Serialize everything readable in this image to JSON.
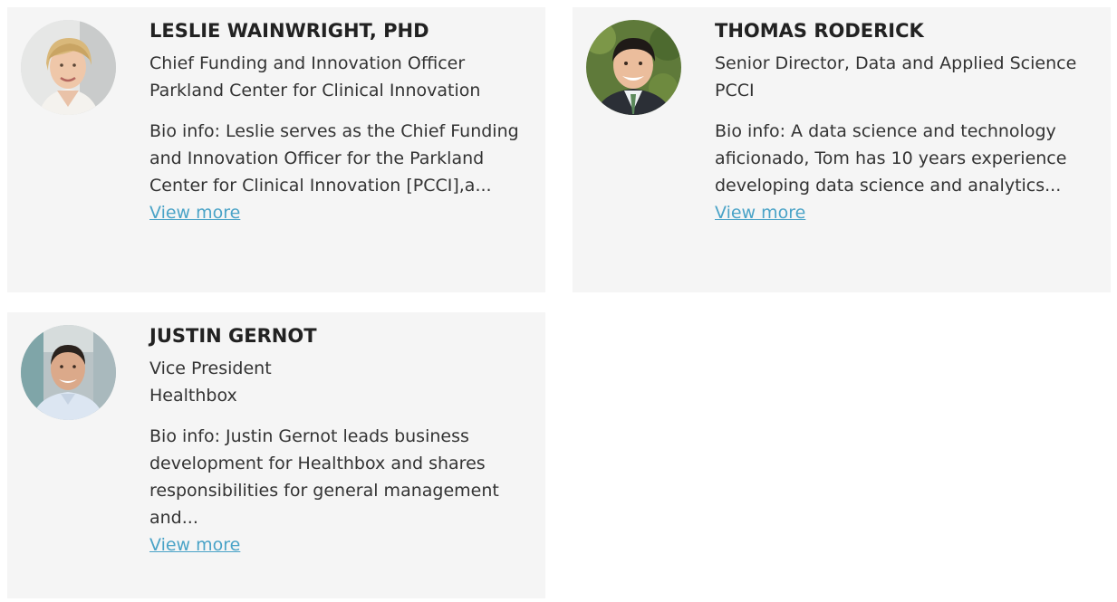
{
  "people": [
    {
      "name": "LESLIE WAINWRIGHT, PHD",
      "title": "Chief Funding and Innovation Officer",
      "organization": "Parkland Center for Clinical Innovation",
      "bio": "Bio info: Leslie serves as the Chief Funding and Innovation Officer for the Parkland Center for Clinical Innovation [PCCI],a...",
      "link_label": "View more"
    },
    {
      "name": "THOMAS RODERICK",
      "title": "Senior Director, Data and Applied Science",
      "organization": "PCCI",
      "bio": "Bio info: A data science and technology aficionado, Tom has 10 years experience developing data science and analytics...",
      "link_label": "View more"
    },
    {
      "name": "JUSTIN GERNOT",
      "title": "Vice President",
      "organization": "Healthbox",
      "bio": "Bio info: Justin Gernot leads business development for Healthbox and shares responsibilities for general management and...",
      "link_label": "View more"
    }
  ],
  "colors": {
    "card_background": "#f5f5f5",
    "link": "#4aa3c7",
    "name_text": "#222222",
    "body_text": "#333333"
  },
  "icons": [
    "avatar-photo-leslie",
    "avatar-photo-thomas",
    "avatar-photo-justin"
  ]
}
